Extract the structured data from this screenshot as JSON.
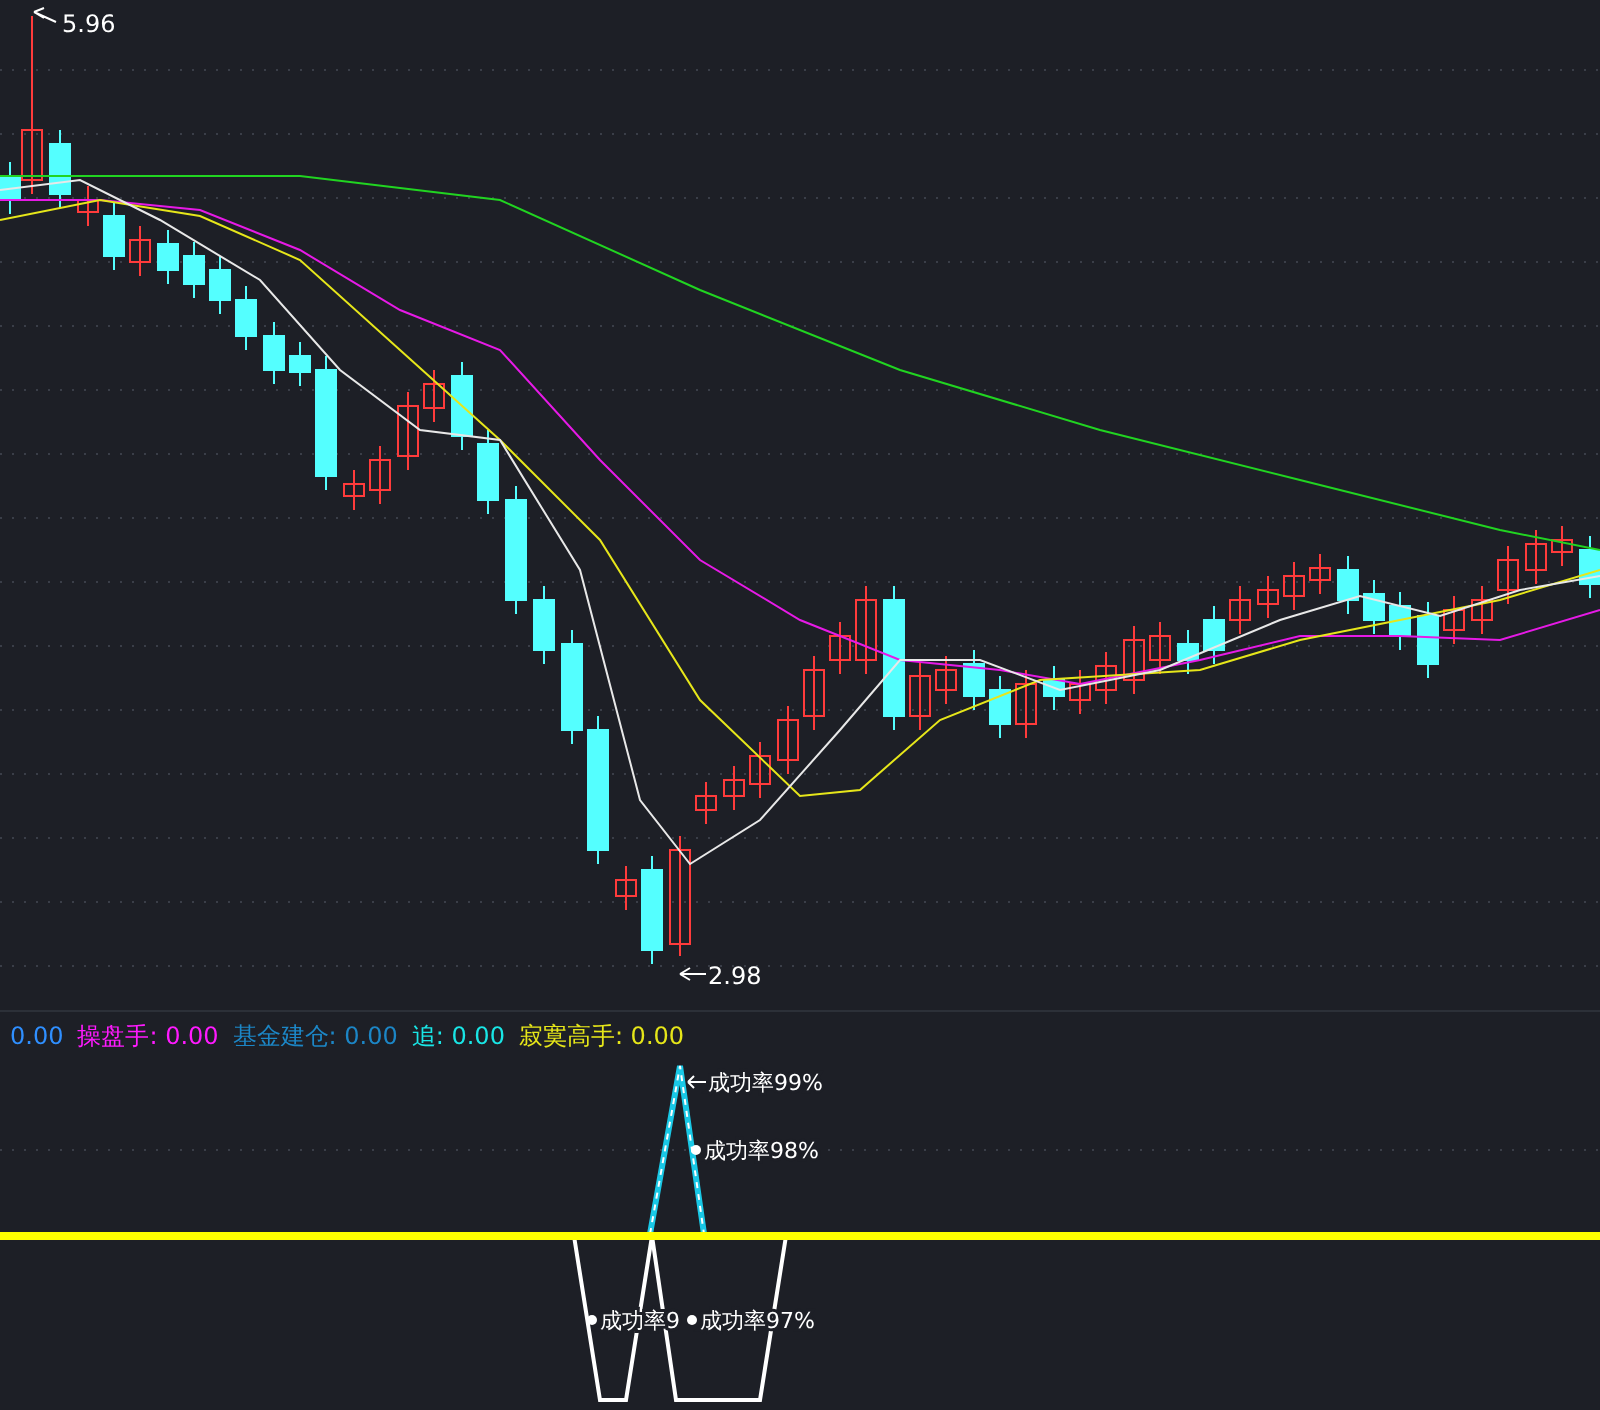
{
  "price_chart": {
    "high_label": "5.96",
    "low_label": "2.98"
  },
  "legend": [
    {
      "text": "0.00",
      "color": "#2f8fff"
    },
    {
      "text": "操盘手: 0.00",
      "color": "#ff1aff"
    },
    {
      "text": "基金建仓: 0.00",
      "color": "#1c86c6"
    },
    {
      "text": "追: 0.00",
      "color": "#19e6e6"
    },
    {
      "text": "寂寞高手: 0.00",
      "color": "#e6e619"
    }
  ],
  "signal_panel": {
    "labels": [
      {
        "kind": "arrow",
        "text": "成功率99%"
      },
      {
        "kind": "dot",
        "text": "成功率98%"
      },
      {
        "kind": "dot",
        "text": "成功率9"
      },
      {
        "kind": "dot",
        "text": "成功率97%"
      }
    ]
  }
}
